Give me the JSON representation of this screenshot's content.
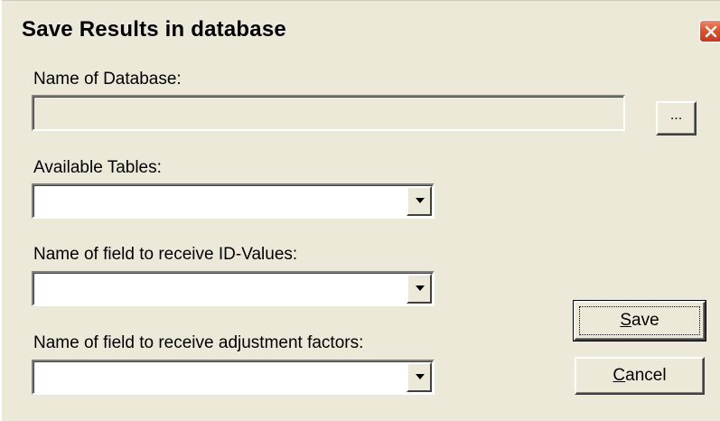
{
  "window": {
    "title": "Save Results in database",
    "close_icon": "close-x-icon"
  },
  "database": {
    "label": "Name of Database:",
    "value": "",
    "browse_label": "..."
  },
  "tables": {
    "label": "Available Tables:",
    "selected": ""
  },
  "id_field": {
    "label": "Name of field to receive ID-Values:",
    "selected": ""
  },
  "adjust_field": {
    "label": "Name of field to receive adjustment factors:",
    "selected": ""
  },
  "buttons": {
    "save_accel": "S",
    "save_rest": "ave",
    "cancel_accel": "C",
    "cancel_rest": "ancel"
  },
  "colors": {
    "dialog_bg": "#ece9d8",
    "close_button": "#e0532d"
  }
}
